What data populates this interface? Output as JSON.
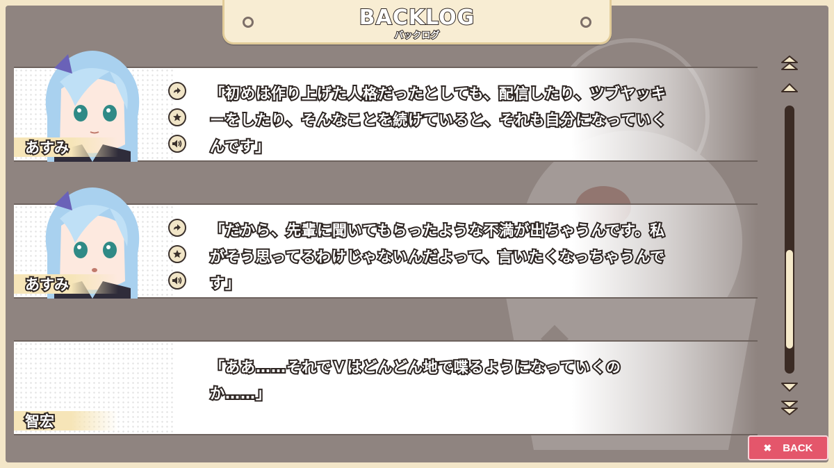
{
  "header": {
    "title": "BACKLOG",
    "subtitle": "バックログ"
  },
  "entries": [
    {
      "speaker": "あすみ",
      "text": "「初めは作り上げた人格だったとしても、配信したり、ツブヤッキーをしたり、そんなことを続けていると、それも自分になっていくんです」",
      "has_portrait": true,
      "portrait_icon": "asumi-portrait",
      "actions": [
        "jump-icon",
        "favorite-star-icon",
        "voice-replay-icon"
      ]
    },
    {
      "speaker": "あすみ",
      "text": "「だから、先輩に聞いてもらったような不満が出ちゃうんです。私がそう思ってるわけじゃないんだよって、言いたくなっちゃうんです」",
      "has_portrait": true,
      "portrait_icon": "asumi-portrait",
      "actions": [
        "jump-icon",
        "favorite-star-icon",
        "voice-replay-icon"
      ]
    },
    {
      "speaker": "智宏",
      "text": "「ああ……それでＶはどんどん地で喋るようになっていくのか……」",
      "has_portrait": false,
      "actions": []
    }
  ],
  "scroll": {
    "position": 0.86,
    "buttons": [
      "scroll-top-icon",
      "scroll-up-icon",
      "scroll-down-icon",
      "scroll-bottom-icon"
    ]
  },
  "back_button": {
    "label": "BACK",
    "icon": "close-x-icon"
  },
  "colors": {
    "frame": "#8f8480",
    "panel": "#f8edd3",
    "text_outline": "#2d2522",
    "back_button": "#e4566b",
    "scroll_track": "#3b2b24"
  }
}
